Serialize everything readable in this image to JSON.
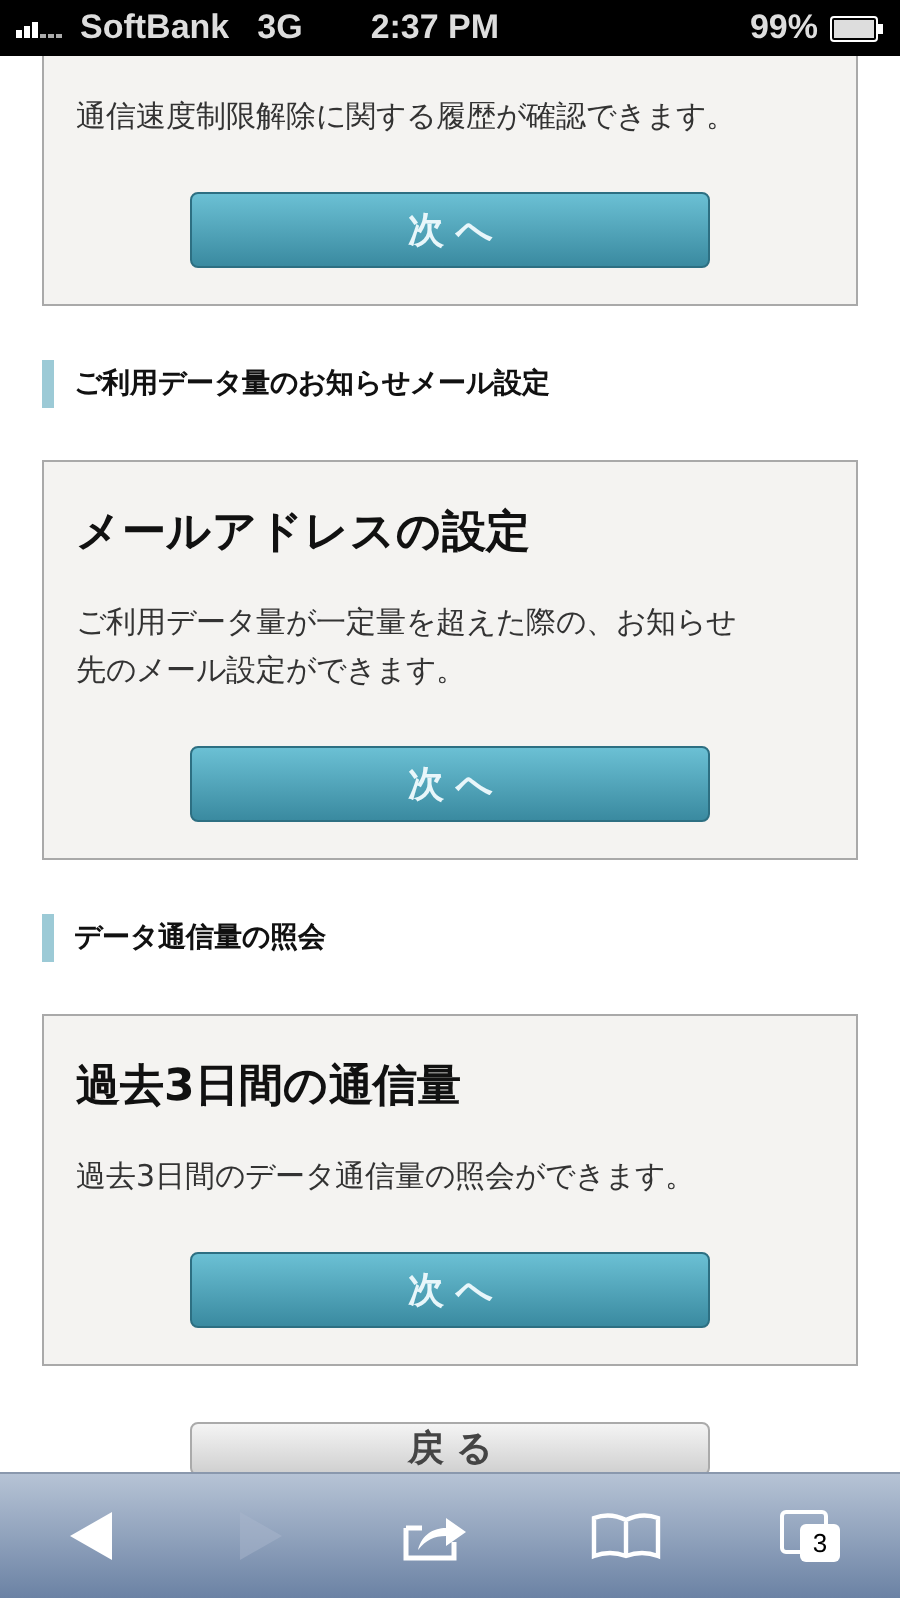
{
  "status_bar": {
    "carrier": "SoftBank",
    "network": "3G",
    "time": "2:37 PM",
    "battery": "99%"
  },
  "sections": [
    {
      "description": "通信速度制限解除に関する履歴が確認できます。",
      "button": "次 へ"
    },
    {
      "heading": "ご利用データ量のお知らせメール設定",
      "title": "メールアドレスの設定",
      "description": "ご利用データ量が一定量を超えた際の、お知らせ先のメール設定ができます。",
      "button": "次 へ"
    },
    {
      "heading": "データ通信量の照会",
      "title": "過去3日間の通信量",
      "description": "過去3日間のデータ通信量の照会ができます。",
      "button": "次 へ"
    }
  ],
  "back_button": "戻 る",
  "toolbar": [
    {
      "kind": "back",
      "disabled": false
    },
    {
      "kind": "forward",
      "disabled": true
    },
    {
      "kind": "share",
      "disabled": false
    },
    {
      "kind": "bookmarks",
      "disabled": false
    },
    {
      "kind": "tabs",
      "disabled": false,
      "count": "3"
    }
  ]
}
